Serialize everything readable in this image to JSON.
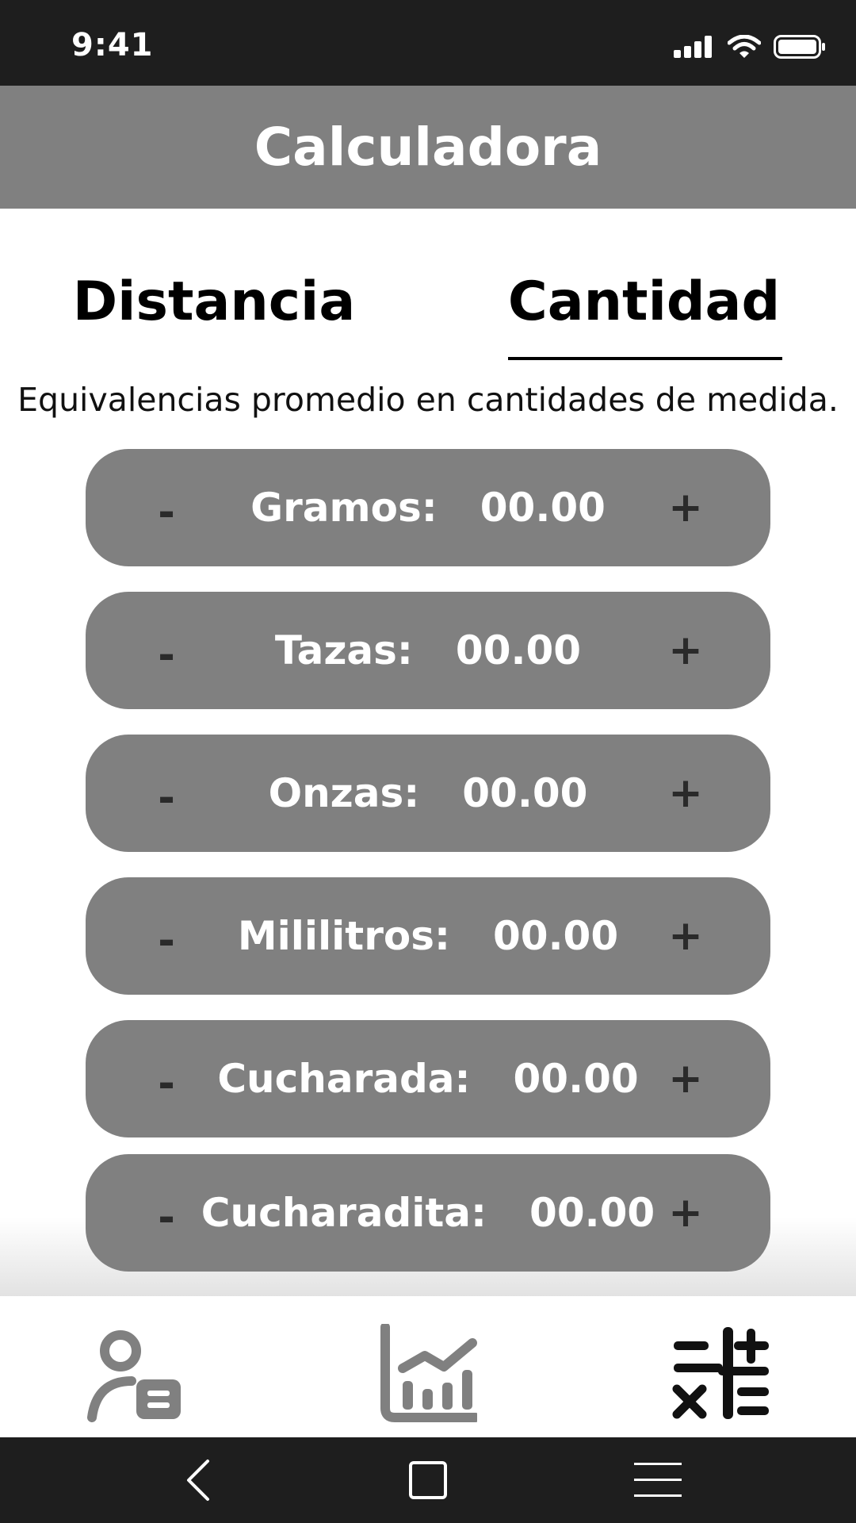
{
  "status_bar": {
    "time": "9:41"
  },
  "header": {
    "title": "Calculadora"
  },
  "tabs": [
    {
      "label": "Distancia",
      "active": false
    },
    {
      "label": "Cantidad",
      "active": true
    }
  ],
  "subtitle": "Equivalencias promedio en cantidades de medida.",
  "converters": [
    {
      "label": "Gramos:",
      "value": "00.00",
      "minus": "-",
      "plus": "+"
    },
    {
      "label": "Tazas:",
      "value": "00.00",
      "minus": "-",
      "plus": "+"
    },
    {
      "label": "Onzas:",
      "value": "00.00",
      "minus": "-",
      "plus": "+"
    },
    {
      "label": "Mililitros:",
      "value": "00.00",
      "minus": "-",
      "plus": "+"
    },
    {
      "label": "Cucharada:",
      "value": "00.00",
      "minus": "-",
      "plus": "+"
    },
    {
      "label": "Cucharadita:",
      "value": "00.00",
      "minus": "-",
      "plus": "+"
    }
  ],
  "bottom_nav": [
    {
      "icon": "user-profile-icon"
    },
    {
      "icon": "chart-icon"
    },
    {
      "icon": "calculator-icon",
      "active": true
    }
  ],
  "system_nav": [
    {
      "icon": "back-icon"
    },
    {
      "icon": "home-icon"
    },
    {
      "icon": "menu-icon"
    }
  ],
  "colors": {
    "header_bg": "#808080",
    "row_bg": "#808080",
    "status_bg": "#1e1e1e",
    "inactive_icon": "#808080",
    "active_icon": "#111111"
  }
}
